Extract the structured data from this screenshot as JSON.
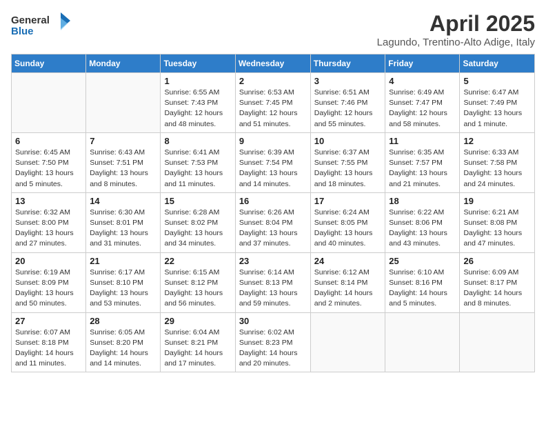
{
  "header": {
    "logo_general": "General",
    "logo_blue": "Blue",
    "month_title": "April 2025",
    "location": "Lagundo, Trentino-Alto Adige, Italy"
  },
  "weekdays": [
    "Sunday",
    "Monday",
    "Tuesday",
    "Wednesday",
    "Thursday",
    "Friday",
    "Saturday"
  ],
  "weeks": [
    [
      {
        "day": "",
        "info": ""
      },
      {
        "day": "",
        "info": ""
      },
      {
        "day": "1",
        "info": "Sunrise: 6:55 AM\nSunset: 7:43 PM\nDaylight: 12 hours and 48 minutes."
      },
      {
        "day": "2",
        "info": "Sunrise: 6:53 AM\nSunset: 7:45 PM\nDaylight: 12 hours and 51 minutes."
      },
      {
        "day": "3",
        "info": "Sunrise: 6:51 AM\nSunset: 7:46 PM\nDaylight: 12 hours and 55 minutes."
      },
      {
        "day": "4",
        "info": "Sunrise: 6:49 AM\nSunset: 7:47 PM\nDaylight: 12 hours and 58 minutes."
      },
      {
        "day": "5",
        "info": "Sunrise: 6:47 AM\nSunset: 7:49 PM\nDaylight: 13 hours and 1 minute."
      }
    ],
    [
      {
        "day": "6",
        "info": "Sunrise: 6:45 AM\nSunset: 7:50 PM\nDaylight: 13 hours and 5 minutes."
      },
      {
        "day": "7",
        "info": "Sunrise: 6:43 AM\nSunset: 7:51 PM\nDaylight: 13 hours and 8 minutes."
      },
      {
        "day": "8",
        "info": "Sunrise: 6:41 AM\nSunset: 7:53 PM\nDaylight: 13 hours and 11 minutes."
      },
      {
        "day": "9",
        "info": "Sunrise: 6:39 AM\nSunset: 7:54 PM\nDaylight: 13 hours and 14 minutes."
      },
      {
        "day": "10",
        "info": "Sunrise: 6:37 AM\nSunset: 7:55 PM\nDaylight: 13 hours and 18 minutes."
      },
      {
        "day": "11",
        "info": "Sunrise: 6:35 AM\nSunset: 7:57 PM\nDaylight: 13 hours and 21 minutes."
      },
      {
        "day": "12",
        "info": "Sunrise: 6:33 AM\nSunset: 7:58 PM\nDaylight: 13 hours and 24 minutes."
      }
    ],
    [
      {
        "day": "13",
        "info": "Sunrise: 6:32 AM\nSunset: 8:00 PM\nDaylight: 13 hours and 27 minutes."
      },
      {
        "day": "14",
        "info": "Sunrise: 6:30 AM\nSunset: 8:01 PM\nDaylight: 13 hours and 31 minutes."
      },
      {
        "day": "15",
        "info": "Sunrise: 6:28 AM\nSunset: 8:02 PM\nDaylight: 13 hours and 34 minutes."
      },
      {
        "day": "16",
        "info": "Sunrise: 6:26 AM\nSunset: 8:04 PM\nDaylight: 13 hours and 37 minutes."
      },
      {
        "day": "17",
        "info": "Sunrise: 6:24 AM\nSunset: 8:05 PM\nDaylight: 13 hours and 40 minutes."
      },
      {
        "day": "18",
        "info": "Sunrise: 6:22 AM\nSunset: 8:06 PM\nDaylight: 13 hours and 43 minutes."
      },
      {
        "day": "19",
        "info": "Sunrise: 6:21 AM\nSunset: 8:08 PM\nDaylight: 13 hours and 47 minutes."
      }
    ],
    [
      {
        "day": "20",
        "info": "Sunrise: 6:19 AM\nSunset: 8:09 PM\nDaylight: 13 hours and 50 minutes."
      },
      {
        "day": "21",
        "info": "Sunrise: 6:17 AM\nSunset: 8:10 PM\nDaylight: 13 hours and 53 minutes."
      },
      {
        "day": "22",
        "info": "Sunrise: 6:15 AM\nSunset: 8:12 PM\nDaylight: 13 hours and 56 minutes."
      },
      {
        "day": "23",
        "info": "Sunrise: 6:14 AM\nSunset: 8:13 PM\nDaylight: 13 hours and 59 minutes."
      },
      {
        "day": "24",
        "info": "Sunrise: 6:12 AM\nSunset: 8:14 PM\nDaylight: 14 hours and 2 minutes."
      },
      {
        "day": "25",
        "info": "Sunrise: 6:10 AM\nSunset: 8:16 PM\nDaylight: 14 hours and 5 minutes."
      },
      {
        "day": "26",
        "info": "Sunrise: 6:09 AM\nSunset: 8:17 PM\nDaylight: 14 hours and 8 minutes."
      }
    ],
    [
      {
        "day": "27",
        "info": "Sunrise: 6:07 AM\nSunset: 8:18 PM\nDaylight: 14 hours and 11 minutes."
      },
      {
        "day": "28",
        "info": "Sunrise: 6:05 AM\nSunset: 8:20 PM\nDaylight: 14 hours and 14 minutes."
      },
      {
        "day": "29",
        "info": "Sunrise: 6:04 AM\nSunset: 8:21 PM\nDaylight: 14 hours and 17 minutes."
      },
      {
        "day": "30",
        "info": "Sunrise: 6:02 AM\nSunset: 8:23 PM\nDaylight: 14 hours and 20 minutes."
      },
      {
        "day": "",
        "info": ""
      },
      {
        "day": "",
        "info": ""
      },
      {
        "day": "",
        "info": ""
      }
    ]
  ]
}
